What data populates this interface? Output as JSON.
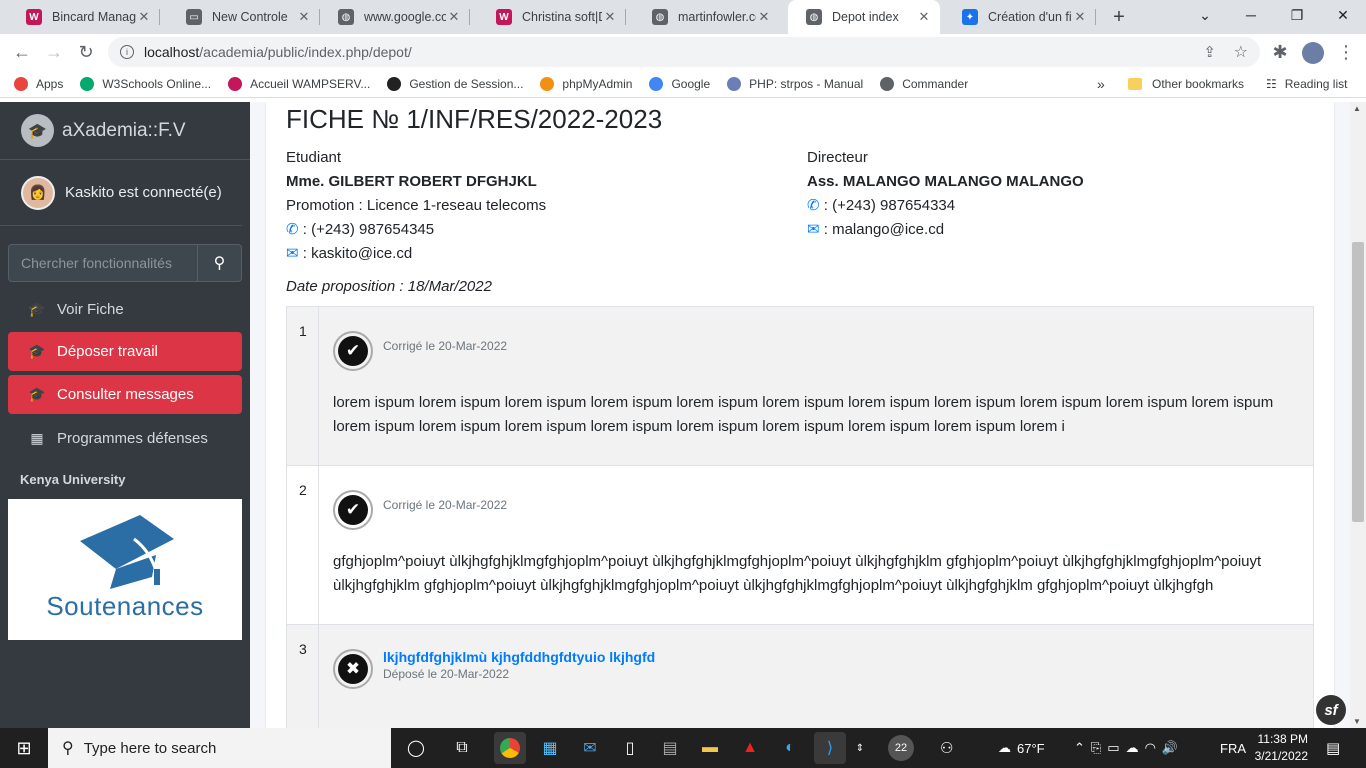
{
  "browser": {
    "tabs": [
      {
        "title": "Bincard Manager",
        "fav_color": "#c2185b",
        "fav": "W"
      },
      {
        "title": "New Controle",
        "fav_color": "#5f6368",
        "fav": "▭"
      },
      {
        "title": "www.google.com",
        "fav_color": "#5f6368",
        "fav": "◍"
      },
      {
        "title": "Christina soft|Das",
        "fav_color": "#c2185b",
        "fav": "W"
      },
      {
        "title": "martinfowler.com",
        "fav_color": "#5f6368",
        "fav": "◍"
      },
      {
        "title": "Depot index",
        "fav_color": "#5f6368",
        "fav": "◍"
      },
      {
        "title": "Création d'un fic",
        "fav_color": "#1a73e8",
        "fav": "✦"
      }
    ],
    "new_tab": "+",
    "url_host": "localhost",
    "url_path": "/academia/public/index.php/depot/",
    "bookmarks": [
      {
        "label": "Apps",
        "color": "#e8453c",
        "icon": "apps-icon"
      },
      {
        "label": "W3Schools Online...",
        "color": "#04aa6d",
        "icon": "w3schools-icon"
      },
      {
        "label": "Accueil WAMPSERV...",
        "color": "#c2185b",
        "icon": "wamp-icon"
      },
      {
        "label": "Gestion de Session...",
        "color": "#222222",
        "icon": "symfony-icon"
      },
      {
        "label": "phpMyAdmin",
        "color": "#f29111",
        "icon": "phpmyadmin-icon"
      },
      {
        "label": "Google",
        "color": "#4285f4",
        "icon": "google-icon"
      },
      {
        "label": "PHP: strpos - Manual",
        "color": "#6c7eb7",
        "icon": "php-icon"
      },
      {
        "label": "Commander",
        "color": "#5f6368",
        "icon": "globe-icon"
      }
    ],
    "bookmarks_more": "»",
    "other_bookmarks": "Other bookmarks",
    "reading_list": "Reading list"
  },
  "sidebar": {
    "brand": "aXademia::F.V",
    "user": "Kaskito est connecté(e)",
    "search_placeholder": "Chercher fonctionnalités",
    "items": [
      {
        "label": "Voir Fiche",
        "active": false,
        "icon": "graduation-cap-icon"
      },
      {
        "label": "Déposer travail",
        "active": true,
        "icon": "graduation-cap-icon"
      },
      {
        "label": "Consulter messages",
        "active": true,
        "icon": "graduation-cap-icon"
      },
      {
        "label": "Programmes défenses",
        "active": false,
        "icon": "calendar-icon"
      }
    ],
    "section": "Kenya University",
    "banner_caption": "Soutenances"
  },
  "main": {
    "title": "FICHE № 1/INF/RES/2022-2023",
    "student": {
      "heading": "Etudiant",
      "name": "Mme. GILBERT ROBERT DFGHJKL",
      "promotion": "Promotion : Licence 1-reseau telecoms",
      "phone": ": (+243) 987654345",
      "email": ": kaskito@ice.cd"
    },
    "director": {
      "heading": "Directeur",
      "name": "Ass. MALANGO MALANGO MALANGO",
      "phone": ": (+243) 987654334",
      "email": ": malango@ice.cd"
    },
    "date_proposition": "Date proposition : 18/Mar/2022",
    "rows": [
      {
        "num": "1",
        "status": "corrige",
        "title": "",
        "meta": "Corrigé le 20-Mar-2022",
        "text": "lorem ispum lorem ispum lorem ispum lorem ispum lorem ispum lorem ispum lorem ispum lorem ispum lorem ispum lorem ispum lorem ispum lorem ispum lorem ispum lorem ispum lorem ispum lorem ispum lorem ispum lorem ispum lorem ispum lorem i"
      },
      {
        "num": "2",
        "status": "corrige",
        "title": "",
        "meta": "Corrigé le 20-Mar-2022",
        "text": "gfghjoplm^poiuyt ùlkjhgfghjklmgfghjoplm^poiuyt ùlkjhgfghjklmgfghjoplm^poiuyt ùlkjhgfghjklm gfghjoplm^poiuyt ùlkjhgfghjklmgfghjoplm^poiuyt ùlkjhgfghjklm gfghjoplm^poiuyt ùlkjhgfghjklmgfghjoplm^poiuyt ùlkjhgfghjklmgfghjoplm^poiuyt ùlkjhgfghjklm gfghjoplm^poiuyt ùlkjhgfgh"
      },
      {
        "num": "3",
        "status": "depose",
        "title": "lkjhgfdfghjklmù kjhgfddhgfdtyuio lkjhgfd",
        "meta": "Déposé le 20-Mar-2022",
        "text": ""
      }
    ]
  },
  "taskbar": {
    "search_placeholder": "Type here to search",
    "badge": "22",
    "weather": "67°F",
    "lang": "FRA",
    "time": "11:38 PM",
    "date": "3/21/2022"
  }
}
